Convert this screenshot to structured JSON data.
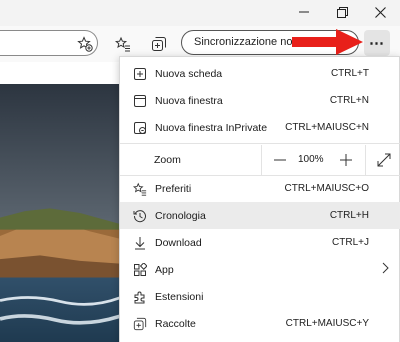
{
  "window": {
    "minimize_icon": "minimize-icon",
    "maximize_icon": "restore-icon",
    "close_icon": "close-icon"
  },
  "toolbar": {
    "sync_label": "Sincronizzazione non in",
    "more_icon": "ellipsis-icon"
  },
  "menu": {
    "items": [
      {
        "label": "Nuova scheda",
        "shortcut": "CTRL+T",
        "icon": "new-tab-icon"
      },
      {
        "label": "Nuova finestra",
        "shortcut": "CTRL+N",
        "icon": "new-window-icon"
      },
      {
        "label": "Nuova finestra InPrivate",
        "shortcut": "CTRL+MAIUSC+N",
        "icon": "inprivate-icon"
      },
      {
        "label": "Preferiti",
        "shortcut": "CTRL+MAIUSC+O",
        "icon": "favorites-icon"
      },
      {
        "label": "Cronologia",
        "shortcut": "CTRL+H",
        "icon": "history-icon"
      },
      {
        "label": "Download",
        "shortcut": "CTRL+J",
        "icon": "download-icon"
      },
      {
        "label": "App",
        "shortcut": "",
        "icon": "apps-icon"
      },
      {
        "label": "Estensioni",
        "shortcut": "",
        "icon": "extensions-icon"
      },
      {
        "label": "Raccolte",
        "shortcut": "CTRL+MAIUSC+Y",
        "icon": "collections-icon"
      }
    ],
    "zoom": {
      "label": "Zoom",
      "value": "100%",
      "minus": "—",
      "plus": "+"
    }
  },
  "colors": {
    "arrow": "#e8201a",
    "highlight": "#ebebeb"
  }
}
